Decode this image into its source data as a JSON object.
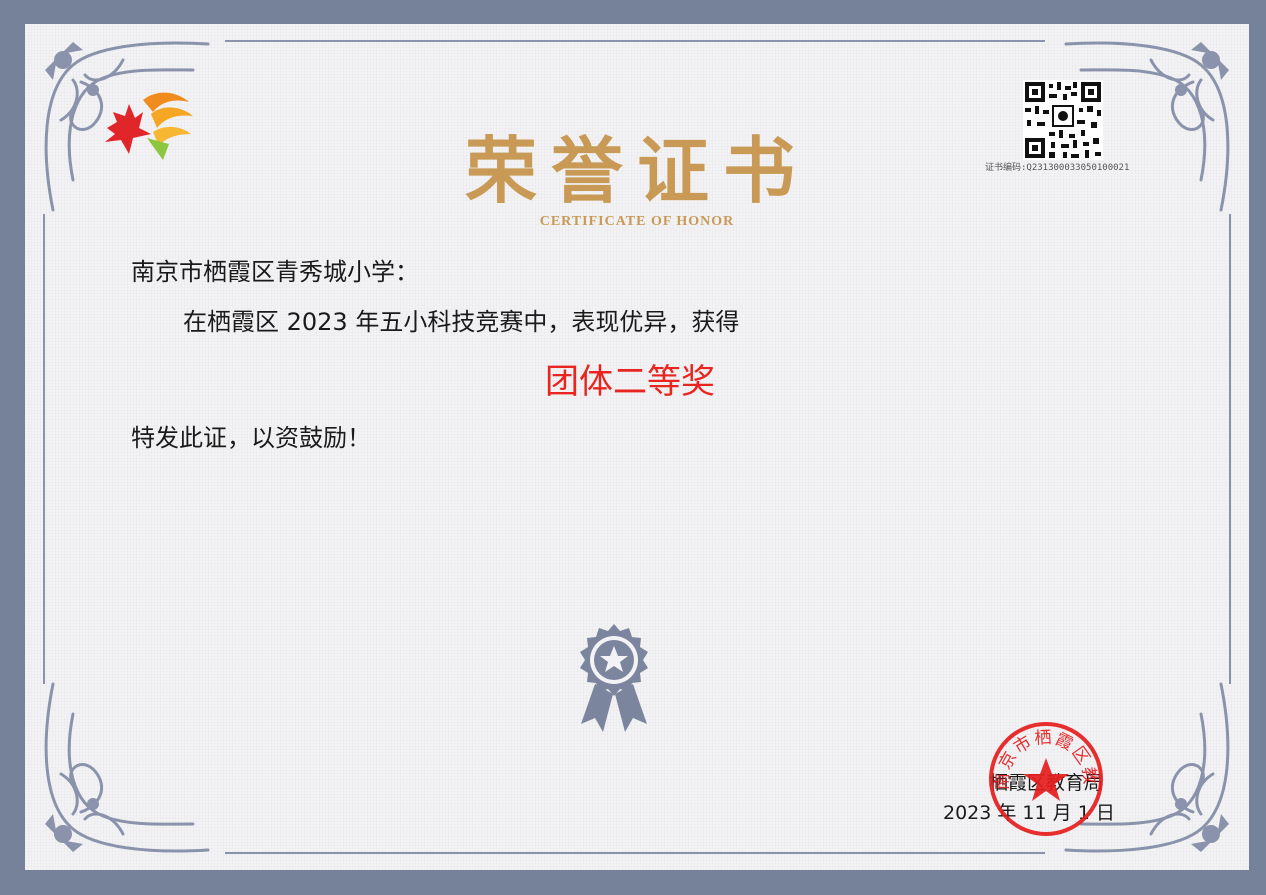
{
  "certificate": {
    "title": "荣誉证书",
    "subtitle": "CERTIFICATE OF HONOR",
    "code": "证书编码:Q231300033050100021",
    "recipient": "南京市栖霞区青秀城小学：",
    "line1": "在栖霞区 2023 年五小科技竞赛中，表现优异，获得",
    "award": "团体二等奖",
    "closing": "特发此证，以资鼓励！",
    "issuer": "栖霞区教育局",
    "date": "2023 年 11 月 1 日",
    "seal_text": "南京市栖霞区教育局"
  },
  "icons": {
    "logo": "flame-wing-logo-icon",
    "qr": "qr-code-icon",
    "badge": "rosette-star-badge-icon",
    "seal": "red-official-seal-icon",
    "corners": "ornamental-corner-icon"
  },
  "colors": {
    "outer_border": "#76829a",
    "paper": "#f3f3f5",
    "ornament": "#8a93ab",
    "title_gold": "#c99a55",
    "award_red": "#e8251f",
    "seal_red": "#e61e1e"
  }
}
